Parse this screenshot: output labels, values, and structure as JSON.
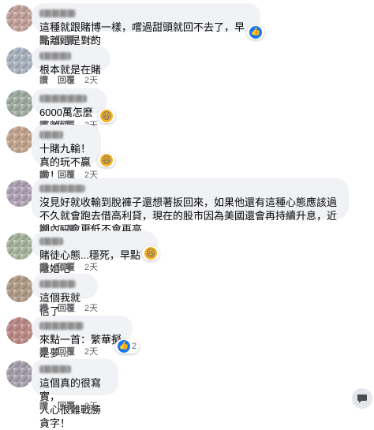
{
  "actions": {
    "like": "讚",
    "reply": "回覆"
  },
  "comments": [
    {
      "text": "這種就跟賭博一樣，嚐過甜頭就回不去了，早點離婚是對的",
      "time": "2天",
      "reaction": "like",
      "reaction_count": ""
    },
    {
      "text": "根本就是在賭",
      "time": "2天"
    },
    {
      "text": "6000萬怎麼不離婚",
      "time": "2天",
      "reaction": "haha",
      "reaction_count": ""
    },
    {
      "text": "十賭九輸！\n真的玩不贏啦！",
      "time": "2天",
      "reaction": "haha",
      "reaction_count": ""
    },
    {
      "text": "沒見好就收輸到脫褲子還想著扳回來，如果他還有這種心態應該過不久就會跑去借高利貸，現在的股市因為美國還會再持續升息，近期內只會更低不會再高",
      "time": "2天"
    },
    {
      "text": "賭徒心態...穩死，早點離婚吧",
      "time": "2天",
      "reaction": "haha",
      "reaction_count": ""
    },
    {
      "text": "這個我就信了",
      "time": "2天"
    },
    {
      "text": "來點一首：繁華擬是夢...",
      "time": "2天",
      "reaction": "like",
      "reaction_count": "2"
    },
    {
      "text": "這個真的很寫實，\n人心很難戰勝貪字！",
      "time": "2天"
    }
  ],
  "colors": {
    "bubble": "#f0f2f5",
    "like": "#1877f2",
    "haha": "#f7b125",
    "meta": "#65676b"
  },
  "icons": {
    "corner": "chat-bubble-icon"
  }
}
